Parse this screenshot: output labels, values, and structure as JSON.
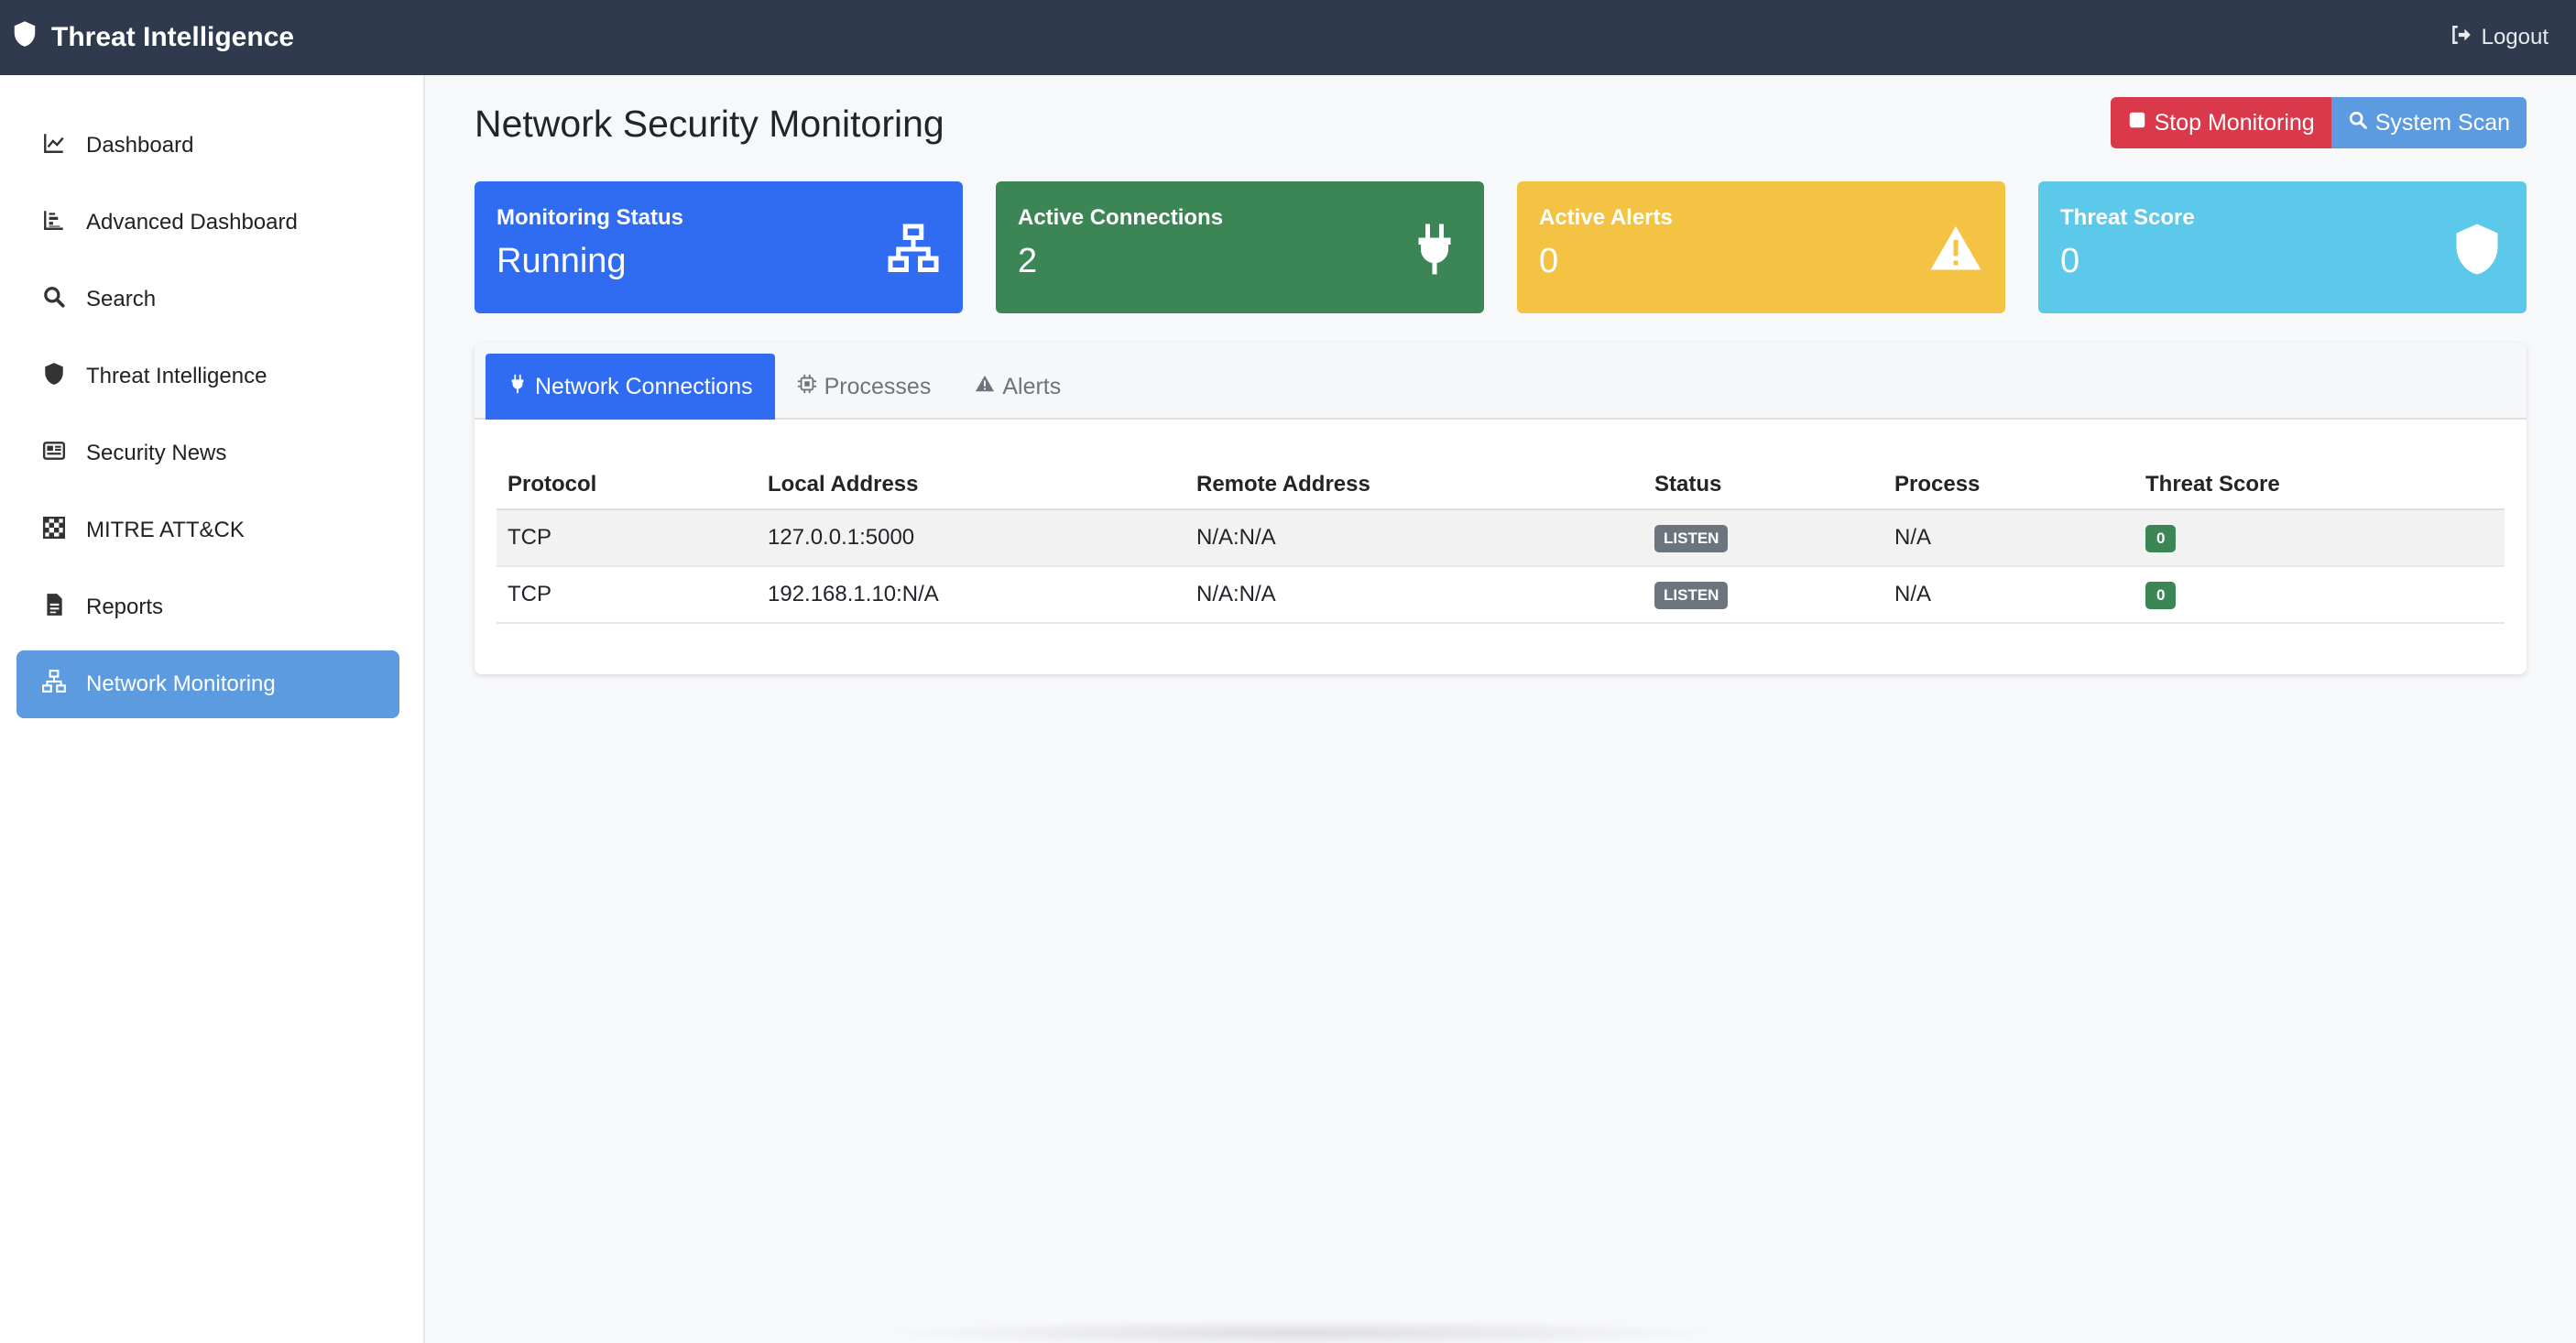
{
  "navbar": {
    "brand": "Threat Intelligence",
    "logout_label": "Logout"
  },
  "sidebar": {
    "items": [
      {
        "label": "Dashboard",
        "icon": "chart-line-icon"
      },
      {
        "label": "Advanced Dashboard",
        "icon": "chart-bar-icon"
      },
      {
        "label": "Search",
        "icon": "search-icon"
      },
      {
        "label": "Threat Intelligence",
        "icon": "shield-icon"
      },
      {
        "label": "Security News",
        "icon": "newspaper-icon"
      },
      {
        "label": "MITRE ATT&CK",
        "icon": "chess-board-icon"
      },
      {
        "label": "Reports",
        "icon": "file-icon"
      },
      {
        "label": "Network Monitoring",
        "icon": "network-icon",
        "active": true
      }
    ]
  },
  "main": {
    "title": "Network Security Monitoring",
    "actions": {
      "stop_label": "Stop Monitoring",
      "scan_label": "System Scan"
    },
    "cards": [
      {
        "label": "Monitoring Status",
        "value": "Running",
        "icon": "network-icon",
        "color": "#2f6cf2"
      },
      {
        "label": "Active Connections",
        "value": "2",
        "icon": "plug-icon",
        "color": "#3c8655"
      },
      {
        "label": "Active Alerts",
        "value": "0",
        "icon": "warning-icon",
        "color": "#f5c343"
      },
      {
        "label": "Threat Score",
        "value": "0",
        "icon": "shield-icon",
        "color": "#5cc8ea"
      }
    ],
    "tabs": [
      {
        "label": "Network Connections",
        "icon": "plug-icon",
        "active": true
      },
      {
        "label": "Processes",
        "icon": "cpu-icon"
      },
      {
        "label": "Alerts",
        "icon": "warning-icon"
      }
    ],
    "table": {
      "headers": [
        "Protocol",
        "Local Address",
        "Remote Address",
        "Status",
        "Process",
        "Threat Score"
      ],
      "rows": [
        {
          "protocol": "TCP",
          "local": "127.0.0.1:5000",
          "remote": "N/A:N/A",
          "status": "LISTEN",
          "process": "N/A",
          "threat_score": "0"
        },
        {
          "protocol": "TCP",
          "local": "192.168.1.10:N/A",
          "remote": "N/A:N/A",
          "status": "LISTEN",
          "process": "N/A",
          "threat_score": "0"
        }
      ]
    }
  }
}
